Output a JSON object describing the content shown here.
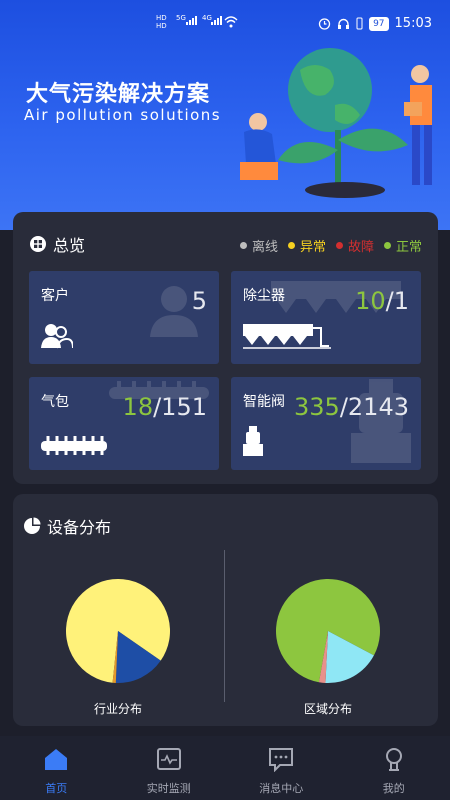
{
  "status_bar": {
    "left_badges": [
      "HD",
      "HD"
    ],
    "network_4g": "4G",
    "network_5g": "5G",
    "battery": "97",
    "time": "15:03"
  },
  "banner": {
    "title": "大气污染解决方案",
    "subtitle": "Air pollution solutions"
  },
  "overview": {
    "title": "总览",
    "legend": [
      {
        "label": "离线",
        "color": "#bdbdbd"
      },
      {
        "label": "异常",
        "color": "#f5d020"
      },
      {
        "label": "故障",
        "color": "#d32f2f"
      },
      {
        "label": "正常",
        "color": "#8dc63f"
      }
    ],
    "tiles": {
      "customers": {
        "label": "客户",
        "value": "5"
      },
      "dust_collector": {
        "label": "除尘器",
        "active": "10",
        "total": "/1"
      },
      "air_bag": {
        "label": "气包",
        "active": "18",
        "total": "/151"
      },
      "smart_valve": {
        "label": "智能阀",
        "active": "335",
        "total": "/2143"
      }
    }
  },
  "distribution": {
    "title": "设备分布",
    "industry_label": "行业分布",
    "region_label": "区域分布"
  },
  "chart_data": [
    {
      "type": "pie",
      "title": "行业分布",
      "slices": [
        {
          "value": 83,
          "color": "#fff27a"
        },
        {
          "value": 16,
          "color": "#1e4ea6"
        },
        {
          "value": 1,
          "color": "#e39a2c"
        }
      ]
    },
    {
      "type": "pie",
      "title": "区域分布",
      "slices": [
        {
          "value": 80,
          "color": "#8dc63f"
        },
        {
          "value": 18,
          "color": "#8fe7f5"
        },
        {
          "value": 2,
          "color": "#e8918a"
        }
      ]
    }
  ],
  "tabbar": {
    "tabs": [
      {
        "label": "首页",
        "icon": "home-icon",
        "active": true
      },
      {
        "label": "实时监测",
        "icon": "monitor-icon",
        "active": false
      },
      {
        "label": "消息中心",
        "icon": "message-icon",
        "active": false
      },
      {
        "label": "我的",
        "icon": "profile-icon",
        "active": false
      }
    ]
  }
}
